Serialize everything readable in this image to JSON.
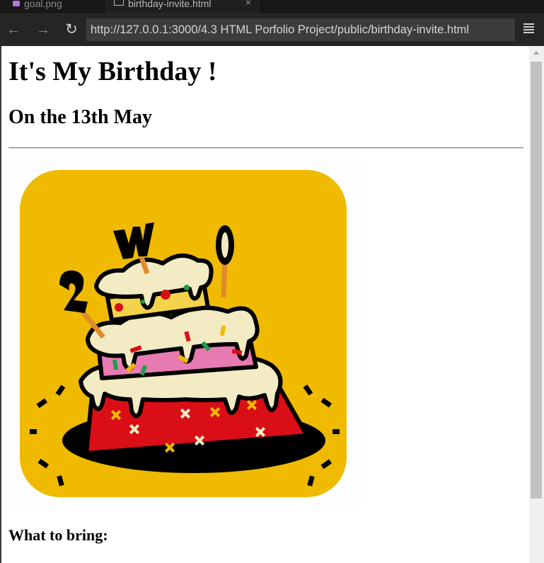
{
  "tabs": [
    {
      "label": "goal.png",
      "icon": "image-icon"
    },
    {
      "label": "birthday-invite.html",
      "icon": "page-icon",
      "close": "×"
    }
  ],
  "nav": {
    "back": "←",
    "forward": "→",
    "reload": "↻",
    "url": "http://127.0.0.1:3000/4.3 HTML Porfolio Project/public/birthday-invite.html"
  },
  "page": {
    "heading": "It's My Birthday !",
    "subheading": "On the 13th May",
    "section_heading": "What to bring:",
    "image_alt": "birthday cake with number 20 candles"
  },
  "colors": {
    "cake_background": "#EFBA00",
    "frosting": "#F2EBC4",
    "pink_layer": "#E87AB2",
    "red_layer": "#D90E17"
  }
}
